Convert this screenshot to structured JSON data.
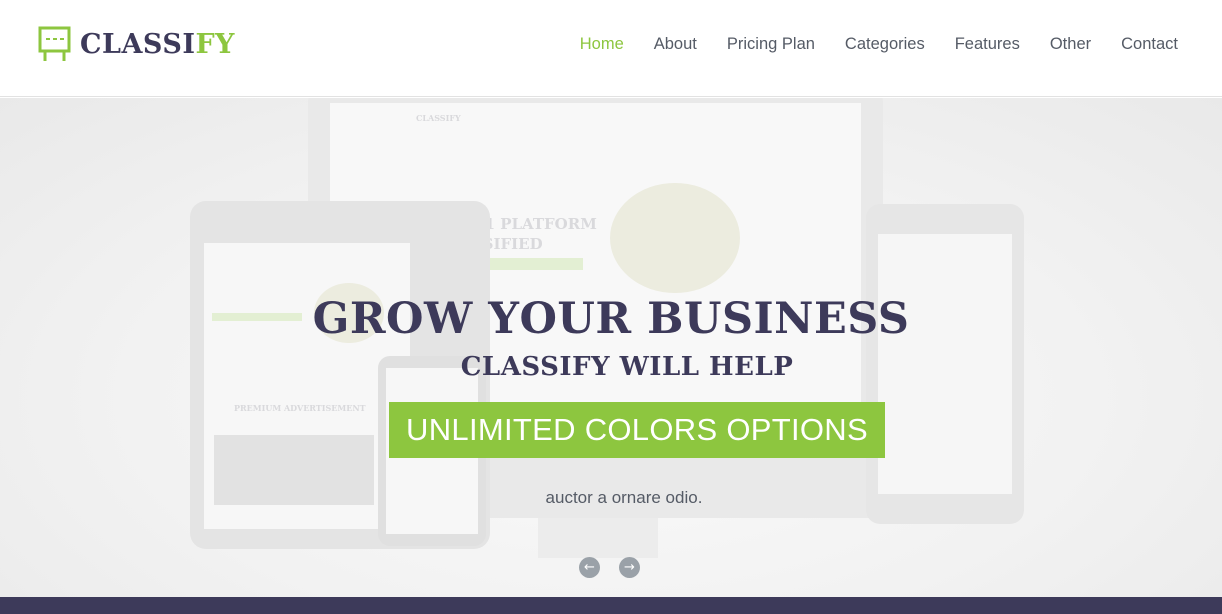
{
  "brand": {
    "name_part1": "CLASSI",
    "name_part2": "FY",
    "colors": {
      "primary": "#3d3a5a",
      "accent": "#8dc63f"
    },
    "logo_icon": "billboard-icon"
  },
  "nav": {
    "items": [
      {
        "label": "Home",
        "active": true
      },
      {
        "label": "About",
        "active": false
      },
      {
        "label": "Pricing Plan",
        "active": false
      },
      {
        "label": "Categories",
        "active": false
      },
      {
        "label": "Features",
        "active": false
      },
      {
        "label": "Other",
        "active": false
      },
      {
        "label": "Contact",
        "active": false
      }
    ]
  },
  "hero": {
    "title": "GROW YOUR BUSINESS",
    "subtitle": "CLASSIFY WILL HELP",
    "badge": "UNLIMITED COLORS OPTIONS",
    "text": "auctor a ornare odio.",
    "mockup_text": {
      "headline_line1": "LD # 1 PLATFORM",
      "headline_line2": "CLASSIFIED",
      "tablet_heading": "PREMIUM ADVERTISEMENT",
      "logo_small": "CLASSIFY"
    },
    "prev_icon": "arrow-left-icon",
    "next_icon": "arrow-right-icon",
    "prev_glyph": "←",
    "next_glyph": "→"
  }
}
